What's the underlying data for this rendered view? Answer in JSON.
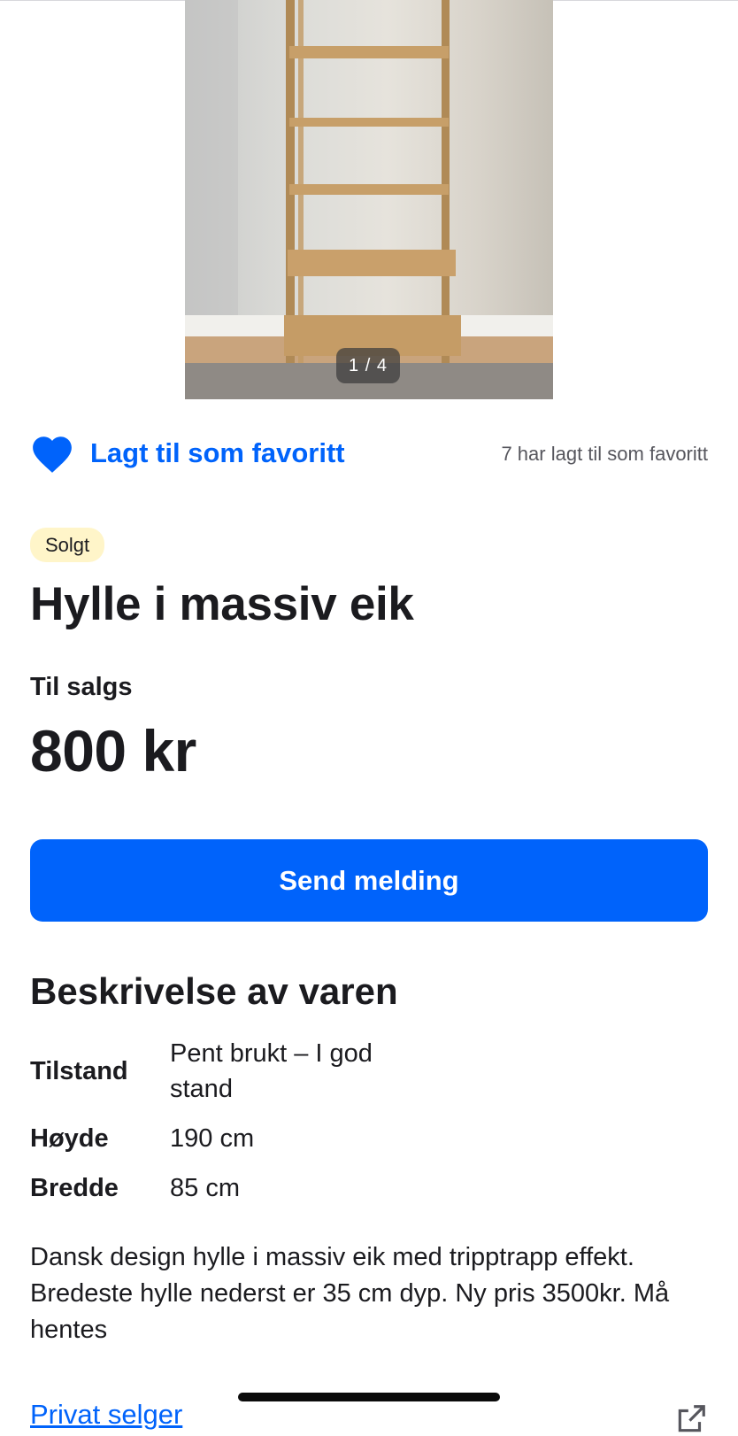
{
  "gallery": {
    "counter": "1 / 4"
  },
  "favorite": {
    "label": "Lagt til som favoritt",
    "count_text": "7 har lagt til som favoritt",
    "icon": "heart-filled-icon",
    "color": "#0063fb"
  },
  "listing": {
    "status_badge": "Solgt",
    "title": "Hylle i massiv eik",
    "sale_type": "Til salgs",
    "price": "800 kr"
  },
  "actions": {
    "send_message": "Send melding"
  },
  "description": {
    "heading": "Beskrivelse av varen",
    "specs": [
      {
        "key": "Tilstand",
        "value": "Pent brukt – I god stand"
      },
      {
        "key": "Høyde",
        "value": "190 cm"
      },
      {
        "key": "Bredde",
        "value": "85 cm"
      }
    ],
    "text": "Dansk design hylle i massiv eik med tripptrapp effekt. Bredeste hylle nederst er 35 cm dyp. Ny pris 3500kr. Må hentes"
  },
  "seller": {
    "link_label": "Privat selger",
    "share_icon": "share-icon"
  },
  "colors": {
    "accent": "#0063fb",
    "badge_bg": "#fff5c9",
    "text": "#1b1b1f"
  }
}
